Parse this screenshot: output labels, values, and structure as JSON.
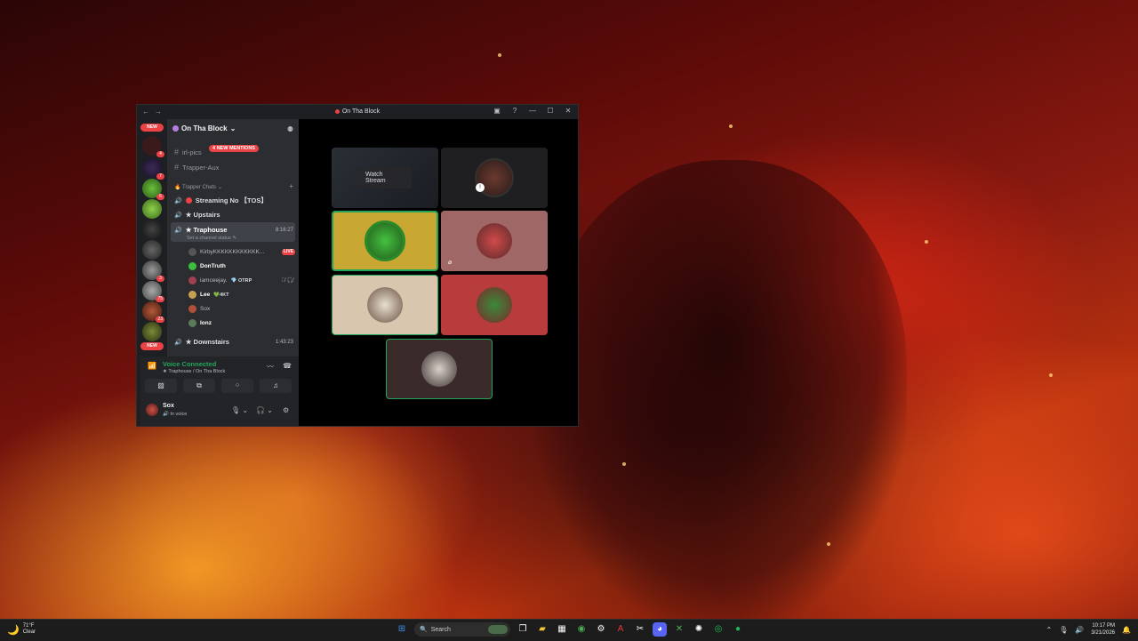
{
  "window": {
    "title": "On Tha Block",
    "nav_back": "←",
    "nav_fwd": "→"
  },
  "servers": {
    "new_top": "NEW",
    "new_bottom": "NEW",
    "badges": [
      "4",
      "7",
      "6",
      "3",
      "75",
      "23"
    ]
  },
  "sidebar": {
    "server_name": "On Tha Block",
    "mentions_pill": "4 NEW MENTIONS",
    "channels_top": [
      "irl-pics",
      "Trapper-Aux"
    ],
    "category": "Trapper Chats",
    "voice_channels": [
      "Streaming No 【TOS】",
      "★ Upstairs"
    ],
    "active_channel": {
      "name": "★ Traphouse",
      "time": "8:16:27",
      "status": "Set a channel status"
    },
    "members": [
      {
        "name": "KirbyKKKKKKKKKKKK...",
        "badge": "LIVE"
      },
      {
        "name": "DonTruth"
      },
      {
        "name": "iamceejay.",
        "tag": "OTRP"
      },
      {
        "name": "Lee",
        "tag": "4KT"
      },
      {
        "name": "Sox"
      },
      {
        "name": "Ionz"
      }
    ],
    "downstairs": {
      "name": "★ Downstairs",
      "time": "1:43:23"
    }
  },
  "voice": {
    "title": "Voice Connected",
    "subtitle": "★ Traphouse / On Tha Block"
  },
  "user": {
    "name": "Sox",
    "status": "In voice"
  },
  "stage": {
    "watch_label": "Watch Stream"
  },
  "taskbar": {
    "temp": "71°F",
    "condition": "Clear",
    "search_placeholder": "Search",
    "time": "10:17 PM",
    "date": "3/21/2026"
  },
  "colors": {
    "accent_green": "#23a559",
    "notification_red": "#ed4245",
    "tile_yellow": "#c9a733",
    "tile_pink": "#a06767",
    "tile_beige": "#d8c7ae",
    "tile_red": "#b83c3c"
  }
}
